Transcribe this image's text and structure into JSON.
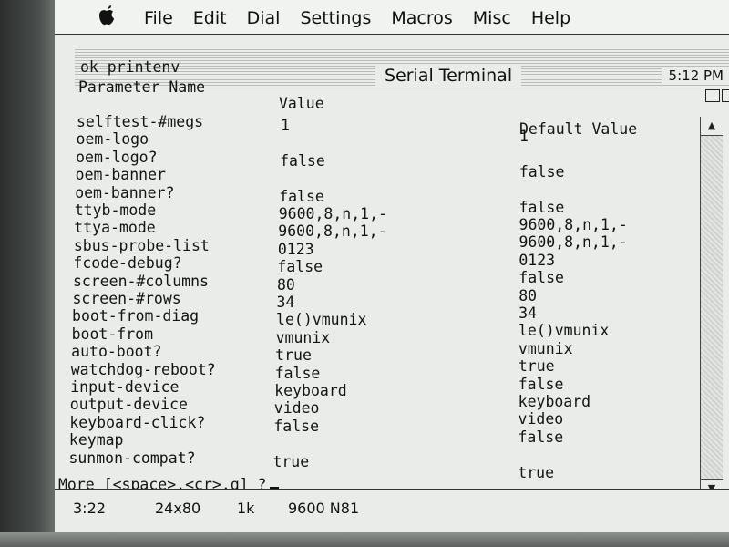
{
  "menubar": {
    "items": [
      "File",
      "Edit",
      "Dial",
      "Settings",
      "Macros",
      "Misc",
      "Help"
    ]
  },
  "window": {
    "title": "Serial Terminal",
    "clock": "5:12 PM"
  },
  "terminal": {
    "prompt_line": "ok printenv",
    "headers": {
      "name": "Parameter Name",
      "value": "Value",
      "default": "Default Value"
    },
    "rows": [
      {
        "name": "selftest-#megs",
        "value": "1",
        "default": "1"
      },
      {
        "name": "oem-logo",
        "value": "",
        "default": ""
      },
      {
        "name": "oem-logo?",
        "value": "false",
        "default": "false"
      },
      {
        "name": "oem-banner",
        "value": "",
        "default": ""
      },
      {
        "name": "oem-banner?",
        "value": "false",
        "default": "false"
      },
      {
        "name": "ttyb-mode",
        "value": "9600,8,n,1,-",
        "default": "9600,8,n,1,-"
      },
      {
        "name": "ttya-mode",
        "value": "9600,8,n,1,-",
        "default": "9600,8,n,1,-"
      },
      {
        "name": "sbus-probe-list",
        "value": "0123",
        "default": "0123"
      },
      {
        "name": "fcode-debug?",
        "value": "false",
        "default": "false"
      },
      {
        "name": "screen-#columns",
        "value": "80",
        "default": "80"
      },
      {
        "name": "screen-#rows",
        "value": "34",
        "default": "34"
      },
      {
        "name": "boot-from-diag",
        "value": "le()vmunix",
        "default": "le()vmunix"
      },
      {
        "name": "boot-from",
        "value": "vmunix",
        "default": "vmunix"
      },
      {
        "name": "auto-boot?",
        "value": "true",
        "default": "true"
      },
      {
        "name": "watchdog-reboot?",
        "value": "false",
        "default": "false"
      },
      {
        "name": "input-device",
        "value": "keyboard",
        "default": "keyboard"
      },
      {
        "name": "output-device",
        "value": "video",
        "default": "video"
      },
      {
        "name": "keyboard-click?",
        "value": "false",
        "default": "false"
      },
      {
        "name": "keymap",
        "value": "",
        "default": ""
      },
      {
        "name": "sunmon-compat?",
        "value": "true",
        "default": "true"
      }
    ],
    "more_prompt": "More [<space>,<cr>,q] ?"
  },
  "statusbar": {
    "cursor_pos": "3:22",
    "dimensions": "24x80",
    "buffer": "1k",
    "line_settings": "9600 N81"
  }
}
